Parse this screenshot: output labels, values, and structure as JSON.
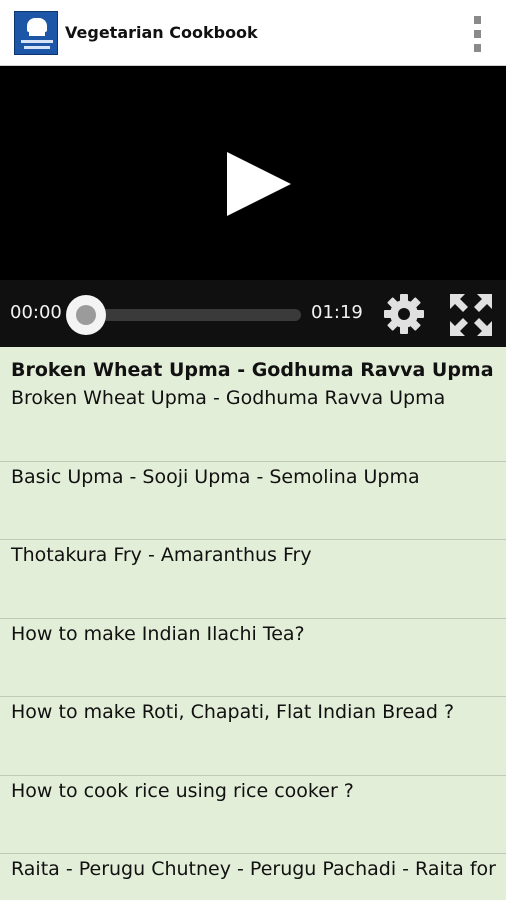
{
  "app": {
    "title": "Vegetarian Cookbook",
    "logo_icon": "chef-hat-logo-icon",
    "menu_icon": "overflow-menu-icon"
  },
  "player": {
    "current_time": "00:00",
    "duration": "01:19",
    "progress_fraction": 0.0,
    "play_icon": "play-icon",
    "settings_icon": "gear-icon",
    "fullscreen_icon": "fullscreen-icon"
  },
  "colors": {
    "list_background": "#e3eed8",
    "player_background": "#000000",
    "appbar_background": "#ffffff",
    "logo_blue": "#1d56a6"
  },
  "list": {
    "heading": "Broken Wheat Upma - Godhuma Ravva Upma",
    "items": [
      {
        "title": "Broken Wheat Upma - Godhuma Ravva Upma"
      },
      {
        "title": "Basic Upma - Sooji Upma - Semolina Upma"
      },
      {
        "title": "Thotakura Fry - Amaranthus Fry"
      },
      {
        "title": "How to make Indian Ilachi Tea?"
      },
      {
        "title": "How to make Roti, Chapati, Flat Indian Bread ?"
      },
      {
        "title": "How to cook rice using rice cooker ?"
      },
      {
        "title": "Raita - Perugu Chutney - Perugu Pachadi - Raita for"
      }
    ]
  }
}
